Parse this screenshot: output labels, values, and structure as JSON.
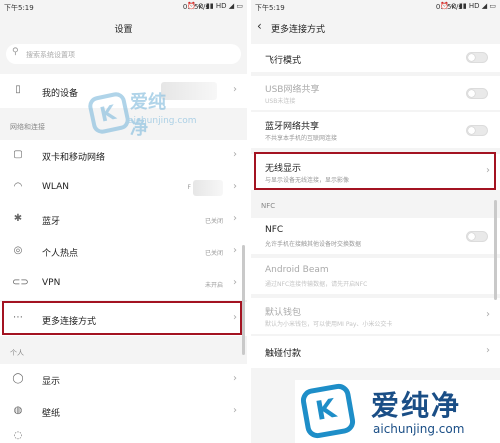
{
  "left": {
    "status": {
      "time": "下午5:19",
      "net": "0.05K/s",
      "icons": "⏰ ⊙ ▮▮ HD ◢ ▭"
    },
    "title": "设置",
    "search_placeholder": "搜索系统设置项",
    "my_device": "我的设备",
    "section_network": "网络和连接",
    "items": [
      {
        "label": "双卡和移动网络",
        "status": "",
        "icon": "sim-icon"
      },
      {
        "label": "WLAN",
        "status": "F",
        "icon": "wifi-icon"
      },
      {
        "label": "蓝牙",
        "status": "已关闭",
        "icon": "bluetooth-icon"
      },
      {
        "label": "个人热点",
        "status": "已关闭",
        "icon": "hotspot-icon"
      },
      {
        "label": "VPN",
        "status": "未开启",
        "icon": "vpn-icon"
      },
      {
        "label": "更多连接方式",
        "status": "",
        "icon": "more-icon"
      }
    ],
    "section_personal": "个人",
    "personal_items": [
      {
        "label": "显示",
        "icon": "display-icon"
      },
      {
        "label": "壁纸",
        "icon": "wallpaper-icon"
      }
    ]
  },
  "right": {
    "status": {
      "time": "下午5:19",
      "net": "0.05K/s",
      "icons": "⏰ ⊙ ▮▮ HD ◢ ▭"
    },
    "title": "更多连接方式",
    "airplane": {
      "label": "飞行模式"
    },
    "usb": {
      "label": "USB网络共享",
      "sub": "USB未连接"
    },
    "bt_share": {
      "label": "蓝牙网络共享",
      "sub": "不共享本手机的互联网连接"
    },
    "wireless": {
      "label": "无线显示",
      "sub": "与显示设备无线连接，显示影像"
    },
    "section_nfc": "NFC",
    "nfc": {
      "label": "NFC",
      "sub": "允许手机在接触其他设备时交换数据"
    },
    "beam": {
      "label": "Android Beam",
      "sub": "通过NFC连接传输数据，请先开启NFC"
    },
    "wallet": {
      "label": "默认钱包",
      "sub": "默认为小米钱包，可以使用MI Pay、小米公交卡"
    },
    "touch_pay": {
      "label": "触碰付款"
    }
  },
  "watermark": {
    "brand": "爱纯净",
    "domain": "aichunjing.com",
    "colors": {
      "light": "#8fc2e0",
      "dark": "#1a4e86",
      "badge": "#1e8ec8"
    }
  },
  "colors": {
    "highlight": "#a31321",
    "bg": "#f4f4f4"
  }
}
